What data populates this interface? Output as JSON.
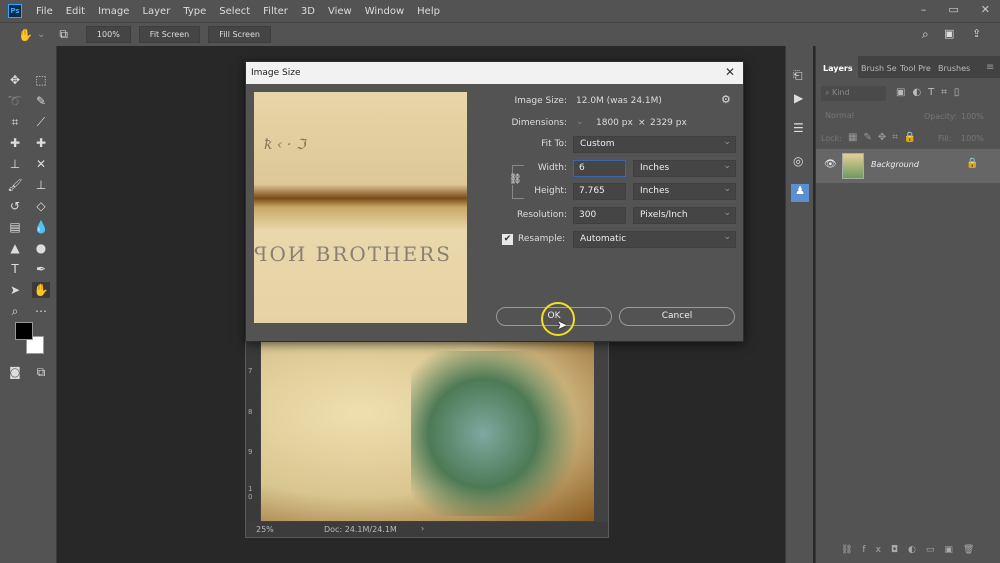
{
  "app": {
    "logo": "Ps"
  },
  "menu": [
    "File",
    "Edit",
    "Image",
    "Layer",
    "Type",
    "Select",
    "Filter",
    "3D",
    "View",
    "Window",
    "Help"
  ],
  "options": {
    "zoom": "100%",
    "fit_screen": "Fit Screen",
    "fill_screen": "Fill Screen"
  },
  "panel": {
    "tabs": [
      "Layers",
      "Brush Se",
      "Tool Pre",
      "Brushes"
    ],
    "kind_placeholder": "Kind",
    "blend_mode": "Normal",
    "opacity_label": "Opacity:",
    "opacity": "100%",
    "lock_label": "Lock:",
    "fill_label": "Fill:",
    "fill": "100%",
    "layer_name": "Background"
  },
  "document": {
    "zoom": "25%",
    "doc_info": "Doc: 24.1M/24.1M",
    "ruler": [
      "7",
      "8",
      "9",
      "1 0"
    ]
  },
  "dialog": {
    "title": "Image Size",
    "image_size_label": "Image Size:",
    "image_size": "12.0M (was 24.1M)",
    "dimensions_label": "Dimensions:",
    "dim_w": "1800 px",
    "dim_x": "×",
    "dim_h": "2329 px",
    "fit_to_label": "Fit To:",
    "fit_to": "Custom",
    "width_label": "Width:",
    "width": "6",
    "width_unit": "Inches",
    "height_label": "Height:",
    "height": "7.765",
    "height_unit": "Inches",
    "resolution_label": "Resolution:",
    "resolution": "300",
    "resolution_unit": "Pixels/Inch",
    "resample_label": "Resample:",
    "resample_checked": true,
    "resample": "Automatic",
    "ok": "OK",
    "cancel": "Cancel"
  },
  "colors": {
    "accent": "#31a8ff",
    "highlight": "#f0e020"
  }
}
